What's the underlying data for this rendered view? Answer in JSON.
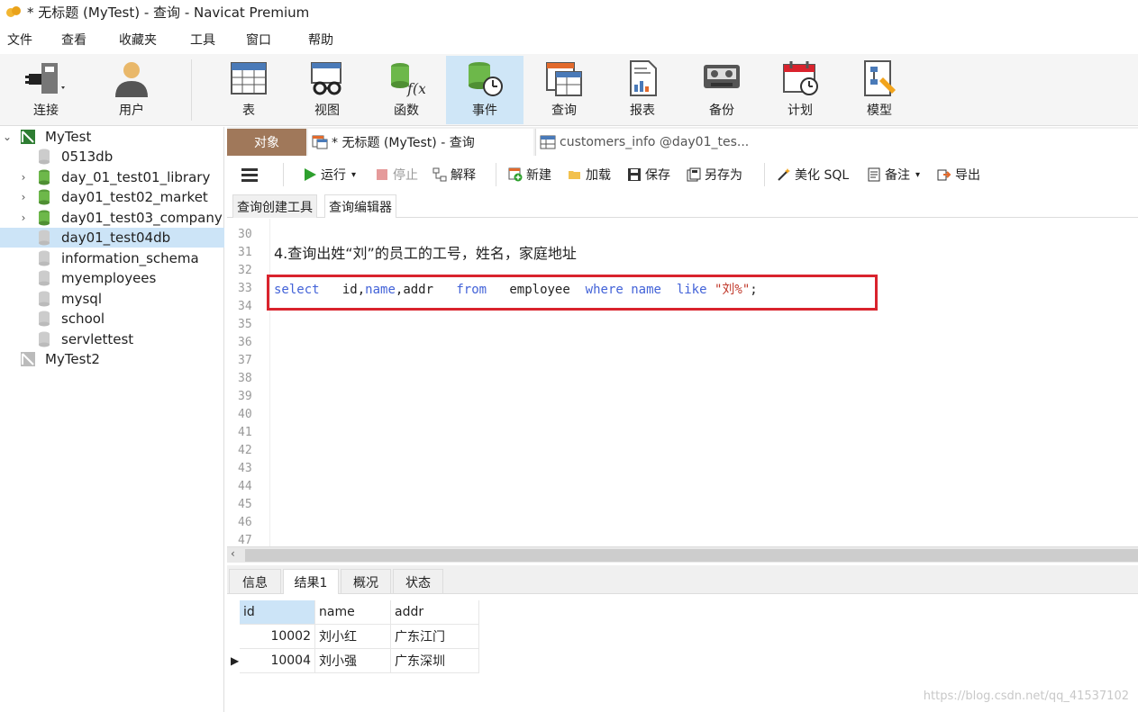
{
  "window": {
    "title": "* 无标题 (MyTest) - 查询 - Navicat Premium"
  },
  "menu": [
    "文件",
    "查看",
    "收藏夹",
    "工具",
    "窗口",
    "帮助"
  ],
  "toolbar": [
    {
      "label": "连接",
      "icon": "plug-icon"
    },
    {
      "label": "用户",
      "icon": "user-icon"
    },
    {
      "label": "表",
      "icon": "table-icon"
    },
    {
      "label": "视图",
      "icon": "view-icon"
    },
    {
      "label": "函数",
      "icon": "function-icon"
    },
    {
      "label": "事件",
      "icon": "event-icon",
      "active": true
    },
    {
      "label": "查询",
      "icon": "query-icon"
    },
    {
      "label": "报表",
      "icon": "report-icon"
    },
    {
      "label": "备份",
      "icon": "backup-icon"
    },
    {
      "label": "计划",
      "icon": "schedule-icon"
    },
    {
      "label": "模型",
      "icon": "model-icon"
    }
  ],
  "sidebar": {
    "items": [
      {
        "label": "MyTest",
        "type": "connection",
        "expanded": true
      },
      {
        "label": "0513db",
        "type": "db"
      },
      {
        "label": "day_01_test01_library",
        "type": "db-open"
      },
      {
        "label": "day01_test02_market",
        "type": "db-open"
      },
      {
        "label": "day01_test03_company",
        "type": "db-open"
      },
      {
        "label": "day01_test04db",
        "type": "db",
        "selected": true
      },
      {
        "label": "information_schema",
        "type": "db"
      },
      {
        "label": "myemployees",
        "type": "db"
      },
      {
        "label": "mysql",
        "type": "db"
      },
      {
        "label": "school",
        "type": "db"
      },
      {
        "label": "servlettest",
        "type": "db"
      },
      {
        "label": "MyTest2",
        "type": "connection"
      }
    ]
  },
  "tabs": {
    "objects": "对象",
    "query": "* 无标题 (MyTest) - 查询",
    "customers": "customers_info @day01_tes..."
  },
  "edit_toolbar": {
    "run": "运行",
    "stop": "停止",
    "explain": "解释",
    "new": "新建",
    "load": "加载",
    "save": "保存",
    "save_as": "另存为",
    "beautify": "美化 SQL",
    "comment": "备注",
    "export": "导出"
  },
  "subtabs": [
    "查询创建工具",
    "查询编辑器"
  ],
  "editor": {
    "line_numbers": [
      "30",
      "31",
      "32",
      "33",
      "34",
      "35",
      "36",
      "37",
      "38",
      "39",
      "40",
      "41",
      "42",
      "43",
      "44",
      "45",
      "46",
      "47"
    ],
    "comment_line": "4.查询出姓“刘”的员工的工号，姓名，家庭地址",
    "sql": {
      "select": "select",
      "cols_a": "id,",
      "name1": "name",
      "cols_b": ",addr",
      "from": "from",
      "table": "employee",
      "where": "where",
      "name2": "name",
      "like": "like",
      "pattern": "\"刘%\"",
      "end": ";"
    }
  },
  "result_tabs": [
    "信息",
    "结果1",
    "概况",
    "状态"
  ],
  "result": {
    "columns": [
      "id",
      "name",
      "addr"
    ],
    "rows": [
      [
        "10002",
        "刘小红",
        "广东江门"
      ],
      [
        "10004",
        "刘小强",
        "广东深圳"
      ]
    ]
  },
  "watermark": "https://blog.csdn.net/qq_41537102"
}
